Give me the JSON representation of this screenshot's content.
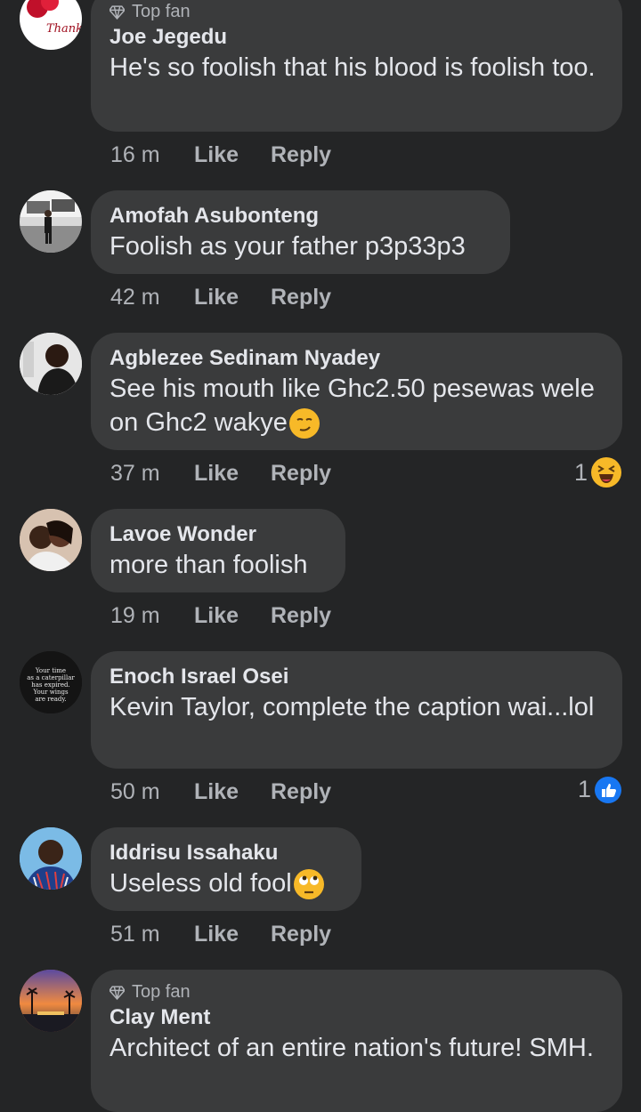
{
  "comments": [
    {
      "badge": "Top fan",
      "author": "Joe Jegedu",
      "text": "He's so foolish that his blood is foolish too.",
      "time": "16 m",
      "like": "Like",
      "reply": "Reply",
      "avatar_text": "Thank U"
    },
    {
      "author": "Amofah Asubonteng",
      "text": "Foolish as your father p3p33p3",
      "time": "42 m",
      "like": "Like",
      "reply": "Reply"
    },
    {
      "author": "Agblezee Sedinam Nyadey",
      "text": "See his mouth like Ghc2.50 pesewas wele on Ghc2 wakye",
      "time": "37 m",
      "like": "Like",
      "reply": "Reply",
      "reaction_count": "1",
      "reaction_icon": "laugh-emoji-icon"
    },
    {
      "author": "Lavoe Wonder",
      "text": "more than foolish",
      "time": "19 m",
      "like": "Like",
      "reply": "Reply"
    },
    {
      "author": "Enoch Israel Osei",
      "text": "Kevin Taylor, complete the caption wai...lol",
      "time": "50 m",
      "like": "Like",
      "reply": "Reply",
      "reaction_count": "1",
      "reaction_icon": "like-thumb-icon",
      "avatar_text": "Your time as a caterpillar has expired. Your wings are ready."
    },
    {
      "author": "Iddrisu Issahaku",
      "text": "Useless old fool",
      "time": "51 m",
      "like": "Like",
      "reply": "Reply"
    },
    {
      "badge": "Top fan",
      "author": "Clay Ment",
      "text": "Architect of an entire nation's future! SMH."
    }
  ],
  "colors": {
    "background": "#242526",
    "bubble": "#3a3b3c",
    "text": "#e4e6eb",
    "muted": "#b0b3b8",
    "like_blue": "#1877f2",
    "emoji_yellow": "#f7b928"
  }
}
